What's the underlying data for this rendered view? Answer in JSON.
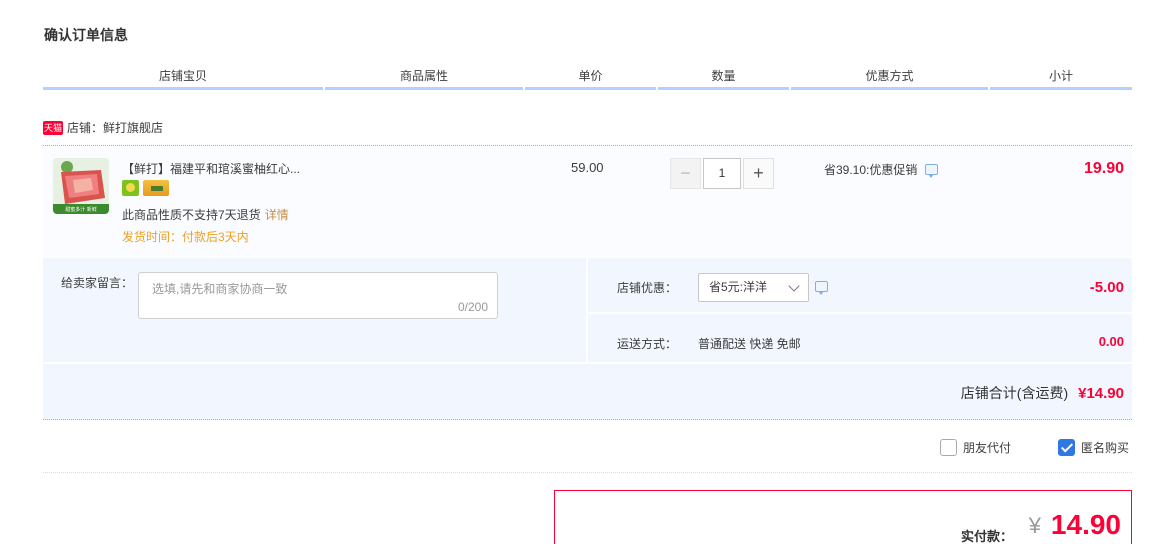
{
  "page_title": "确认订单信息",
  "columns": [
    {
      "label": "店铺宝贝"
    },
    {
      "label": "商品属性"
    },
    {
      "label": "单价"
    },
    {
      "label": "数量"
    },
    {
      "label": "优惠方式"
    },
    {
      "label": "小计"
    }
  ],
  "shop": {
    "badge": "天猫",
    "label": "店铺：鲜打旗舰店"
  },
  "item": {
    "image_text": "甜蜜多汁 新鲜",
    "title": "【鲜打】福建平和琯溪蜜柚红心...",
    "no_return_text": "此商品性质不支持7天退货",
    "no_return_link": "详情",
    "ship_time": "发货时间：付款后3天内",
    "unit_price": "59.00",
    "quantity": "1",
    "minus": "−",
    "plus": "+",
    "discount": "省39.10:优惠促销",
    "subtotal": "19.90"
  },
  "message": {
    "label": "给卖家留言：",
    "placeholder": "选填,请先和商家协商一致",
    "count": "0/200"
  },
  "shop_promo": {
    "label": "店铺优惠：",
    "selected": "省5元:洋洋",
    "amount": "-5.00"
  },
  "shipping": {
    "label": "运送方式：",
    "method": "普通配送 快递 免邮",
    "amount": "0.00"
  },
  "shop_total": {
    "label": "店铺合计(含运费)",
    "amount": "¥14.90"
  },
  "options": {
    "friend_pay": {
      "label": "朋友代付",
      "checked": false
    },
    "anonymous": {
      "label": "匿名购买",
      "checked": true
    }
  },
  "payment": {
    "label": "实付款：",
    "currency": "¥",
    "amount": "14.90"
  },
  "colors": {
    "accent_red": "#ff0036",
    "header_blue": "#b2d1ff",
    "checkbox_blue": "#2f78e3"
  }
}
